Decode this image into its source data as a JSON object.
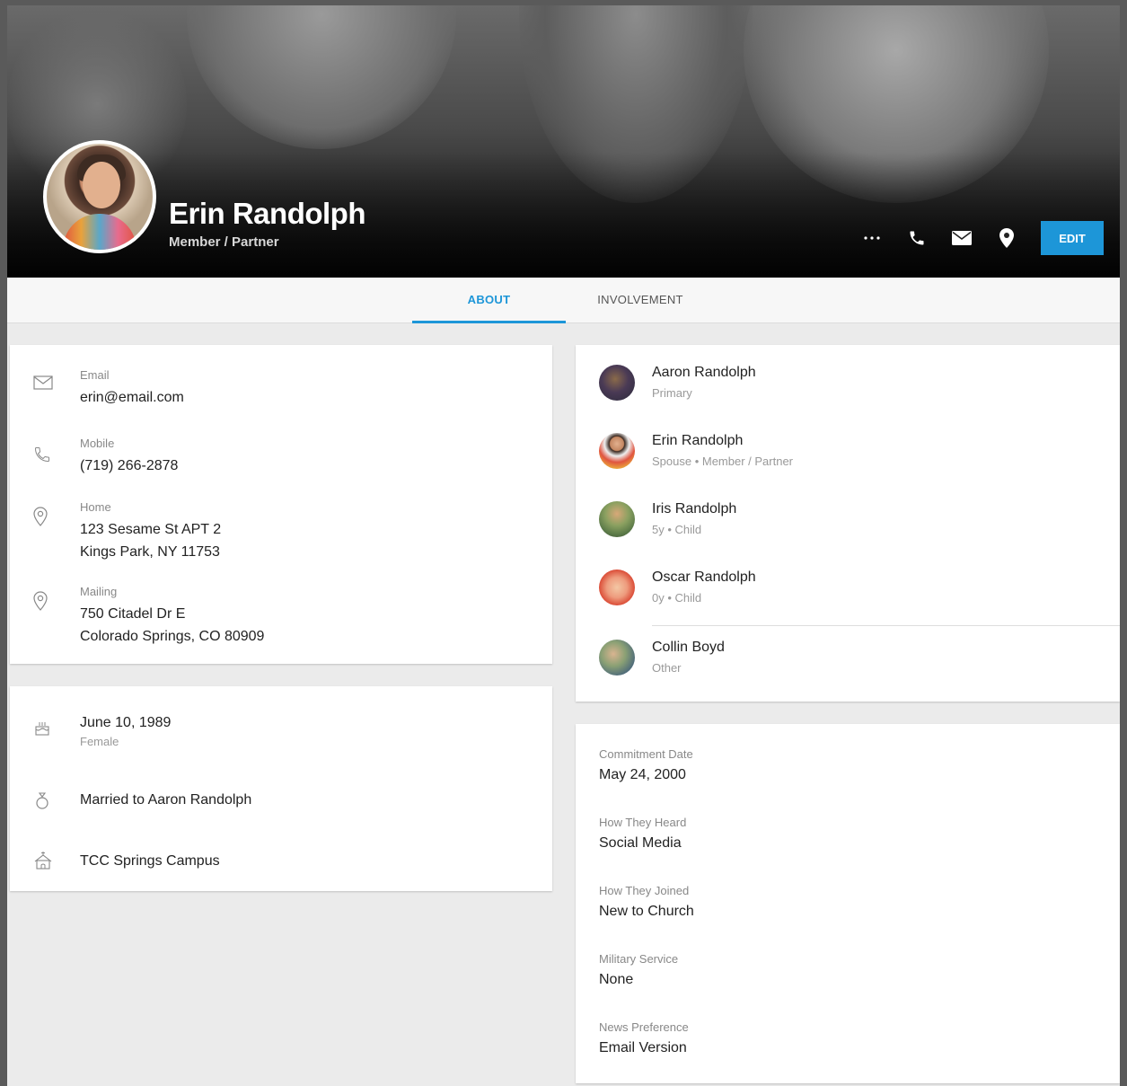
{
  "profile": {
    "name": "Erin Randolph",
    "role": "Member / Partner"
  },
  "actions": {
    "more_icon": "more-horizontal-icon",
    "phone_icon": "phone-icon",
    "email_icon": "envelope-icon",
    "location_icon": "map-pin-icon",
    "edit_label": "EDIT",
    "edit_color": "#1d96d8"
  },
  "tabs": [
    {
      "label": "ABOUT",
      "active": true
    },
    {
      "label": "INVOLVEMENT",
      "active": false
    }
  ],
  "contact": {
    "email_label": "Email",
    "email_value": "erin@email.com",
    "mobile_label": "Mobile",
    "mobile_value": "(719) 266-2878",
    "home_label": "Home",
    "home_line1": "123 Sesame St APT 2",
    "home_line2": "Kings Park, NY 11753",
    "mailing_label": "Mailing",
    "mailing_line1": "750 Citadel Dr E",
    "mailing_line2": "Colorado Springs, CO 80909"
  },
  "personal": {
    "birthdate": "June 10, 1989",
    "gender": "Female",
    "marital": "Married to Aaron Randolph",
    "campus": "TCC Springs Campus"
  },
  "household": [
    {
      "name": "Aaron Randolph",
      "role": "Primary"
    },
    {
      "name": "Erin Randolph",
      "role": "Spouse • Member / Partner"
    },
    {
      "name": "Iris Randolph",
      "role": "5y • Child"
    },
    {
      "name": "Oscar Randolph",
      "role": "0y • Child"
    },
    {
      "name": "Collin Boyd",
      "role": "Other"
    }
  ],
  "fields": [
    {
      "label": "Commitment Date",
      "value": "May 24, 2000"
    },
    {
      "label": "How They Heard",
      "value": "Social Media"
    },
    {
      "label": "How They Joined",
      "value": "New to Church"
    },
    {
      "label": "Military Service",
      "value": "None"
    },
    {
      "label": "News Preference",
      "value": "Email Version"
    }
  ]
}
